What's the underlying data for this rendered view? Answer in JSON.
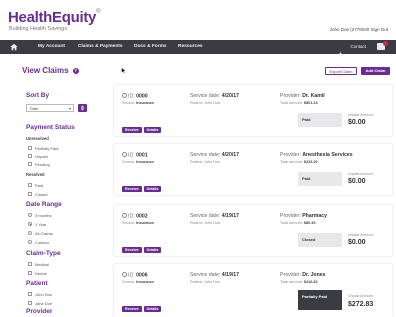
{
  "header": {
    "logo": "HealthEquity",
    "logo_mark": "®",
    "tagline": "Building Health Savings",
    "user_line": "John Doe (2776030 Sign Out"
  },
  "nav": {
    "items": [
      "My Account",
      "Claims & Payments",
      "Docs & Forms",
      "Resources"
    ],
    "contact": "Contact"
  },
  "page": {
    "title": "View Claims",
    "help": "?",
    "export_label": "Export Claim",
    "add_label": "Add Claim"
  },
  "sidebar": {
    "sort_by": "Sort By",
    "sort_value": "Date",
    "payment_status": "Payment Status",
    "unresolved": "Unresolved",
    "unresolved_opts": [
      "Partially Paid",
      "Unpaid",
      "Pending"
    ],
    "resolved": "Resolved",
    "resolved_opts": [
      "Paid",
      "Closed"
    ],
    "date_range": "Date Range",
    "date_opts": [
      "3 months",
      "1 Year",
      "All Claims",
      "Custom"
    ],
    "claim_type": "Claim-Type",
    "claim_opts": [
      "Medical",
      "Dental"
    ],
    "patient": "Patient",
    "patient_opts": [
      "John Doe",
      "Jane Doe"
    ],
    "provider": "Provider"
  },
  "claims": [
    {
      "id_label": "ID:",
      "id": "0000",
      "source_label": "Source:",
      "source": "Insurance",
      "service_label": "Service date:",
      "service_date": "4/20/17",
      "patient_label": "Patient:",
      "patient": "John Doe",
      "provider_label": "Provider:",
      "provider": "Dr. Kamil",
      "total_label": "Total amount:",
      "total": "$801.24",
      "status": "Paid",
      "unpaid_label": "Unpaid Amount:",
      "unpaid": "$0.00"
    },
    {
      "id_label": "ID:",
      "id": "0001",
      "source_label": "Source:",
      "source": "Insurance",
      "service_label": "Service date:",
      "service_date": "4/20/17",
      "patient_label": "Patient:",
      "patient": "John Doe",
      "provider_label": "Provider:",
      "provider": "Anesthesia Services",
      "total_label": "Total amount:",
      "total": "$233.20",
      "status": "Paid",
      "unpaid_label": "Unpaid Amount:",
      "unpaid": "$0.00"
    },
    {
      "id_label": "ID:",
      "id": "0002",
      "source_label": "Source:",
      "source": "Insurance",
      "service_label": "Service date:",
      "service_date": "4/19/17",
      "patient_label": "Patient:",
      "patient": "John Doe",
      "provider_label": "Provider:",
      "provider": "Pharmacy",
      "total_label": "Total amount:",
      "total": "$80.49",
      "status": "Closed",
      "unpaid_label": "Unpaid Amount:",
      "unpaid": "$0.00"
    },
    {
      "id_label": "ID:",
      "id": "0006",
      "source_label": "Source:",
      "source": "Insurance",
      "service_label": "Service date:",
      "service_date": "4/19/17",
      "patient_label": "Patient:",
      "patient": "John Doe",
      "provider_label": "Provider:",
      "provider": "Dr. Jones",
      "total_label": "Total amount:",
      "total": "$416.82",
      "status": "Partially Paid",
      "unpaid_label": "Unpaid Amount:",
      "unpaid": "$272.83"
    }
  ],
  "card_buttons": {
    "receive": "Receive",
    "details": "Details"
  },
  "colors": {
    "brand": "#6a2c91",
    "nav_bg": "#3b3b44",
    "badge": "#d12a47"
  }
}
